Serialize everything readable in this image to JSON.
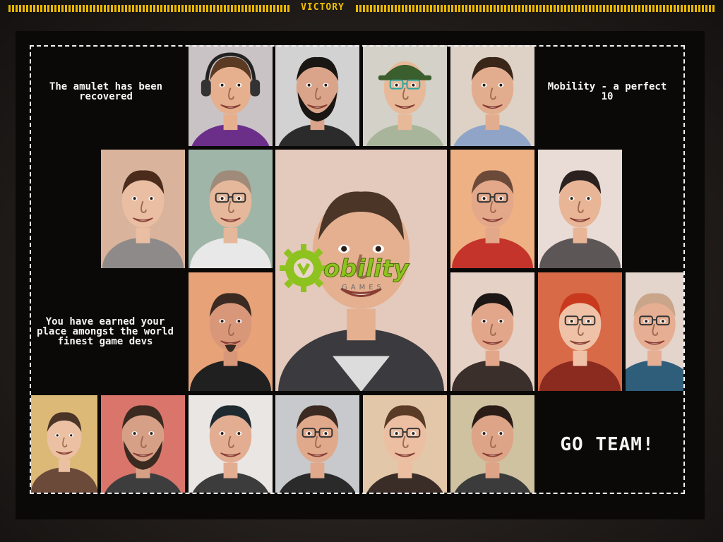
{
  "header": {
    "title": "VICTORY"
  },
  "messages": {
    "amulet": "The amulet has been recovered",
    "mobility": "Mobility - a perfect 10",
    "earned": "You have earned your place amongst the world finest game devs",
    "go_team": "GO TEAM!"
  },
  "logo": {
    "text": "obility",
    "sub": "GAMES",
    "color": "#8dc21f"
  },
  "portraits": [
    {
      "bg": "#c9c3c6",
      "skin": "#e6b08e",
      "hair": "#5a3a22",
      "shirt": "#6b2f8a",
      "acc": "headphones"
    },
    {
      "bg": "#d2d2d2",
      "skin": "#d9a489",
      "hair": "#1a1614",
      "shirt": "#2b2b2b",
      "acc": "beard"
    },
    {
      "bg": "#d4d1c8",
      "skin": "#e8b999",
      "hair": "#3b5e2e",
      "shirt": "#a8b59a",
      "acc": "cap"
    },
    {
      "bg": "#ddd2c5",
      "skin": "#e2ad8e",
      "hair": "#3a2619",
      "shirt": "#8fa4c6",
      "acc": "none"
    },
    {
      "bg": "#d9b39b",
      "skin": "#e9bea3",
      "hair": "#4b2c1c",
      "shirt": "#8e8a8a",
      "acc": "none"
    },
    {
      "bg": "#9fb5a7",
      "skin": "#e6b89b",
      "hair": "#a08a7a",
      "shirt": "#e8e8e8",
      "acc": "glasses"
    },
    {
      "bg": "#eeb184",
      "skin": "#e3a88a",
      "hair": "#6b4a3a",
      "shirt": "#c4342a",
      "acc": "glasses"
    },
    {
      "bg": "#e9dcd6",
      "skin": "#e8b597",
      "hair": "#2b2220",
      "shirt": "#5d5656",
      "acc": "none"
    },
    {
      "bg": "#e8a277",
      "skin": "#d9977a",
      "hair": "#3a2a22",
      "shirt": "#202020",
      "acc": "goatee"
    },
    {
      "bg": "#e6d1c7",
      "skin": "#e2a78a",
      "hair": "#1c1614",
      "shirt": "#3a2f2a",
      "acc": "none"
    },
    {
      "bg": "#d96a47",
      "skin": "#efc2a7",
      "hair": "#c8391e",
      "shirt": "#8b2a1e",
      "acc": "glasses"
    },
    {
      "bg": "#e3d4cc",
      "skin": "#e6ae92",
      "hair": "#c9a58a",
      "shirt": "#2f5e7a",
      "acc": "glasses"
    },
    {
      "bg": "#ddb978",
      "skin": "#ebc0a3",
      "hair": "#4a3526",
      "shirt": "#6b4a3a",
      "acc": "none"
    },
    {
      "bg": "#d9756b",
      "skin": "#d6a087",
      "hair": "#3b2a20",
      "shirt": "#3d3d3d",
      "acc": "beard"
    },
    {
      "bg": "#e9e6e4",
      "skin": "#e3ad92",
      "hair": "#1e2a30",
      "shirt": "#3c3c3c",
      "acc": "none"
    },
    {
      "bg": "#c7c9cc",
      "skin": "#e0a98c",
      "hair": "#3b2a22",
      "shirt": "#2a2a2a",
      "acc": "glasses"
    },
    {
      "bg": "#e2c7a8",
      "skin": "#ecbea2",
      "hair": "#5a3b25",
      "shirt": "#3a2d28",
      "acc": "glasses"
    },
    {
      "bg": "#cfc2a1",
      "skin": "#dda487",
      "hair": "#2a1c16",
      "shirt": "#3b3b3b",
      "acc": "none"
    },
    {
      "bg": "#e4c9bd",
      "skin": "#e4b090",
      "hair": "#4a3526",
      "shirt": "#3b3a3e",
      "acc": "center"
    }
  ]
}
